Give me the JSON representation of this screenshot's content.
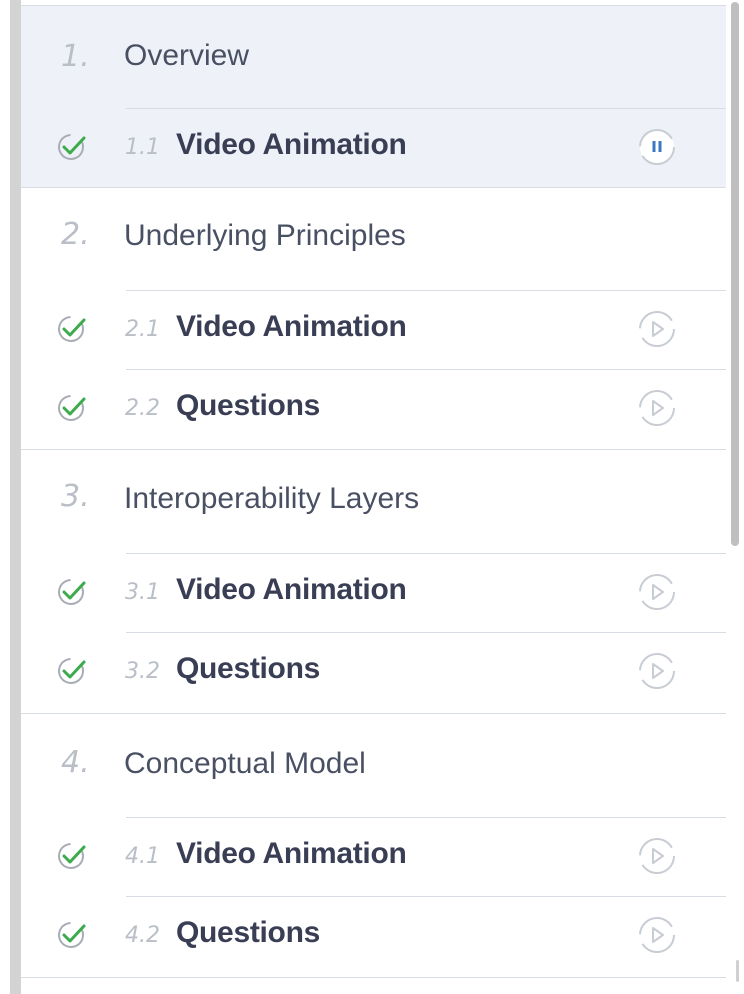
{
  "sections": [
    {
      "number": "1.",
      "title": "Overview",
      "active": true,
      "items": [
        {
          "number": "1.1",
          "title": "Video Animation",
          "completed": true,
          "media_icon": "pause-icon"
        }
      ]
    },
    {
      "number": "2.",
      "title": "Underlying Principles",
      "active": false,
      "items": [
        {
          "number": "2.1",
          "title": "Video Animation",
          "completed": true,
          "media_icon": "play-icon"
        },
        {
          "number": "2.2",
          "title": "Questions",
          "completed": true,
          "media_icon": "play-icon"
        }
      ]
    },
    {
      "number": "3.",
      "title": "Interoperability Layers",
      "active": false,
      "items": [
        {
          "number": "3.1",
          "title": "Video Animation",
          "completed": true,
          "media_icon": "play-icon"
        },
        {
          "number": "3.2",
          "title": "Questions",
          "completed": true,
          "media_icon": "play-icon"
        }
      ]
    },
    {
      "number": "4.",
      "title": "Conceptual Model",
      "active": false,
      "items": [
        {
          "number": "4.1",
          "title": "Video Animation",
          "completed": true,
          "media_icon": "play-icon"
        },
        {
          "number": "4.2",
          "title": "Questions",
          "completed": true,
          "media_icon": "play-icon"
        }
      ]
    }
  ],
  "colors": {
    "check": "#3cab4c",
    "pause": "#3b78c0",
    "active_background": "#eef2f8"
  }
}
